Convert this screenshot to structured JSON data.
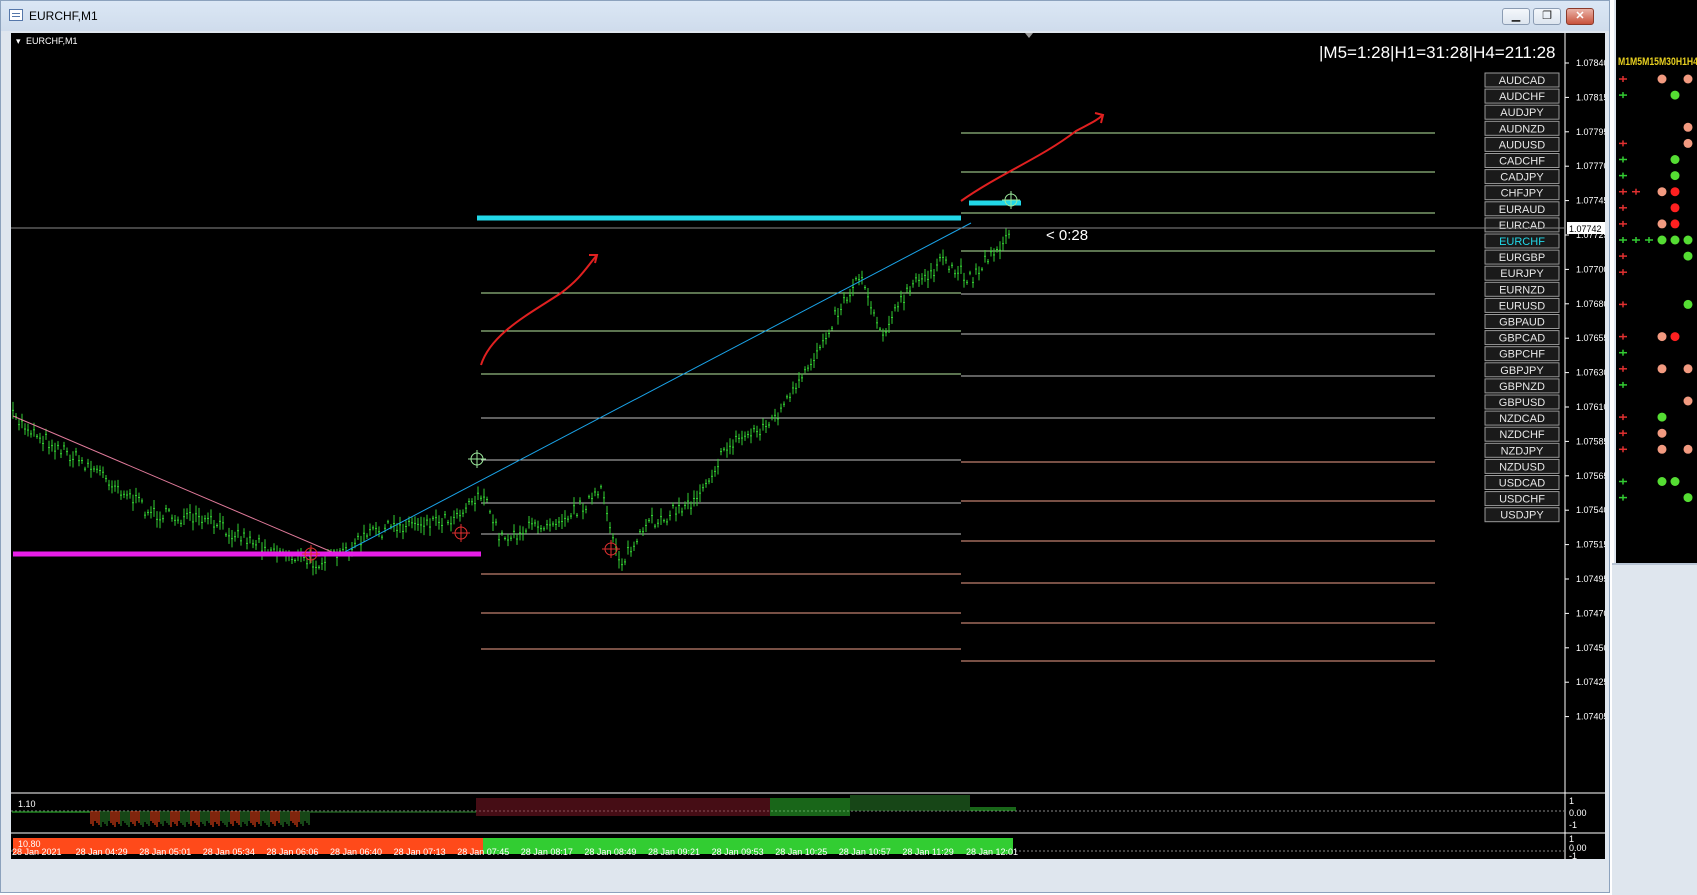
{
  "window": {
    "title": "EURCHF,M1",
    "buttons": [
      "minimize",
      "maximize",
      "close"
    ]
  },
  "chart": {
    "label": "EURCHF,M1",
    "timer_text": "|M5=1:28|H1=31:28|H4=211:28",
    "countdown": "< 0:28",
    "current_price": "1.07742",
    "price_ticks": [
      "1.07840",
      "1.07815",
      "1.07795",
      "1.07770",
      "1.07745",
      "1.07725",
      "1.07700",
      "1.07680",
      "1.07655",
      "1.07630",
      "1.07610",
      "1.07585",
      "1.07565",
      "1.07540",
      "1.07515",
      "1.07495",
      "1.07470",
      "1.07450",
      "1.07425",
      "1.07405"
    ],
    "time_ticks": [
      "28 Jan 2021",
      "28 Jan 04:29",
      "28 Jan 05:01",
      "28 Jan 05:34",
      "28 Jan 06:06",
      "28 Jan 06:40",
      "28 Jan 07:13",
      "28 Jan 07:45",
      "28 Jan 08:17",
      "28 Jan 08:49",
      "28 Jan 09:21",
      "28 Jan 09:53",
      "28 Jan 10:25",
      "28 Jan 10:57",
      "28 Jan 11:29",
      "28 Jan 12:01"
    ],
    "symbols": [
      "AUDCAD",
      "AUDCHF",
      "AUDJPY",
      "AUDNZD",
      "AUDUSD",
      "CADCHF",
      "CADJPY",
      "CHFJPY",
      "EURAUD",
      "EURCAD",
      "EURCHF",
      "EURGBP",
      "EURJPY",
      "EURNZD",
      "EURUSD",
      "GBPAUD",
      "GBPCAD",
      "GBPCHF",
      "GBPJPY",
      "GBPNZD",
      "GBPUSD",
      "NZDCAD",
      "NZDCHF",
      "NZDJPY",
      "NZDUSD",
      "USDCAD",
      "USDCHF",
      "USDJPY"
    ],
    "active_symbol": "EURCHF",
    "colors": {
      "bull": "#32cd32",
      "up_line": "#1aa3e8",
      "down_line": "#e07a9a",
      "support": "#e81ee8",
      "resistance": "#22d8e8",
      "arrow": "#e02020",
      "panel_red": "#ff4a1a",
      "panel_green": "#32cd32"
    }
  },
  "indicator1": {
    "label": "1.10",
    "ticks": [
      "1",
      "0.00",
      "-1"
    ]
  },
  "indicator2": {
    "label": "10.80",
    "ticks": [
      "1",
      "0.00",
      "-1"
    ]
  },
  "side_panel": {
    "header": "M1M5M15M30H1H4"
  }
}
